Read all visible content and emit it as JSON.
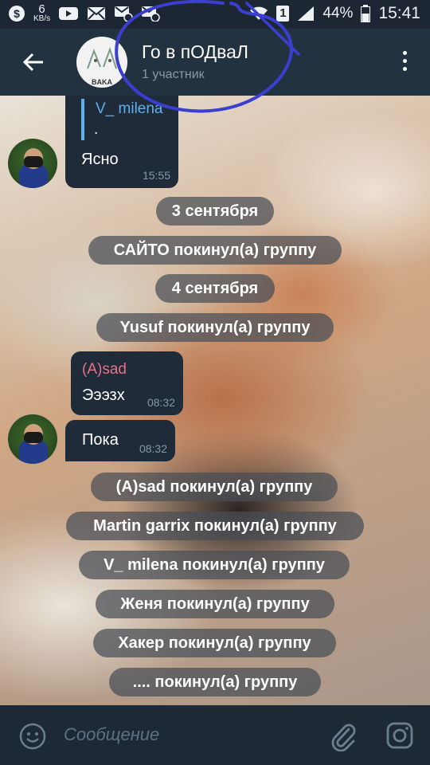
{
  "status_bar": {
    "speed_value": "6",
    "speed_unit": "KB/s",
    "sim_label": "1",
    "battery": "44%",
    "time": "15:41"
  },
  "header": {
    "title": "Го в пОДваЛ",
    "subtitle": "1 участник",
    "avatar_caption": "BAKA"
  },
  "messages": {
    "m1": {
      "reply_name": "V_ milena",
      "reply_text": ".",
      "text": "Ясно",
      "time": "15:55"
    },
    "m2": {
      "sender": "(A)sad",
      "text": "Эээзх",
      "time": "08:32"
    },
    "m3": {
      "text": "Пока",
      "time": "08:32"
    }
  },
  "service": {
    "date1": "3 сентября",
    "left1": "САЙТО покинул(а) группу",
    "date2": "4 сентября",
    "left2": "Yusuf покинул(а) группу",
    "left3": "(A)sad покинул(а) группу",
    "left4": "Martin garrix покинул(а) группу",
    "left5": "V_ milena покинул(а) группу",
    "left6": "Женя покинул(а) группу",
    "left7": "Хакер покинул(а) группу",
    "left8": ".... покинул(а) группу"
  },
  "input": {
    "placeholder": "Сообщение"
  },
  "colors": {
    "header_bg": "#233241",
    "bubble_bg": "#1f2b38",
    "sender_name": "#e8708a",
    "reply_name": "#5fb0ec",
    "scribble": "#3b3fd0"
  },
  "icons": [
    "signal-icon",
    "youtube-icon",
    "mail-icon",
    "wifi-icon",
    "battery-icon",
    "back-arrow-icon",
    "more-vert-icon",
    "emoji-icon",
    "attach-icon",
    "camera-icon"
  ]
}
